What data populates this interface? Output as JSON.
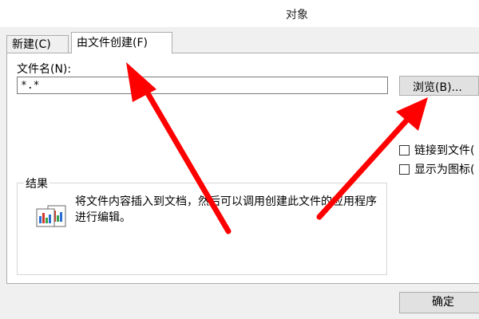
{
  "window": {
    "title": "对象"
  },
  "tabs": [
    {
      "label": "新建(C)",
      "active": false
    },
    {
      "label": "由文件创建(F)",
      "active": true
    }
  ],
  "from_file": {
    "filename_label": "文件名(N):",
    "filename_value": "*.*",
    "browse_label": "浏览(B)...",
    "link_to_file_label": "链接到文件(",
    "display_as_icon_label": "显示为图标("
  },
  "result": {
    "group_label": "结果",
    "description": "将文件内容插入到文档，然后可以调用创建此文件的应用程序进行编辑。"
  },
  "footer": {
    "ok_label": "确定"
  },
  "colors": {
    "annotation_arrow": "#ff0000",
    "dialog_bg": "#f0f0f0",
    "panel_bg": "#ffffff"
  }
}
